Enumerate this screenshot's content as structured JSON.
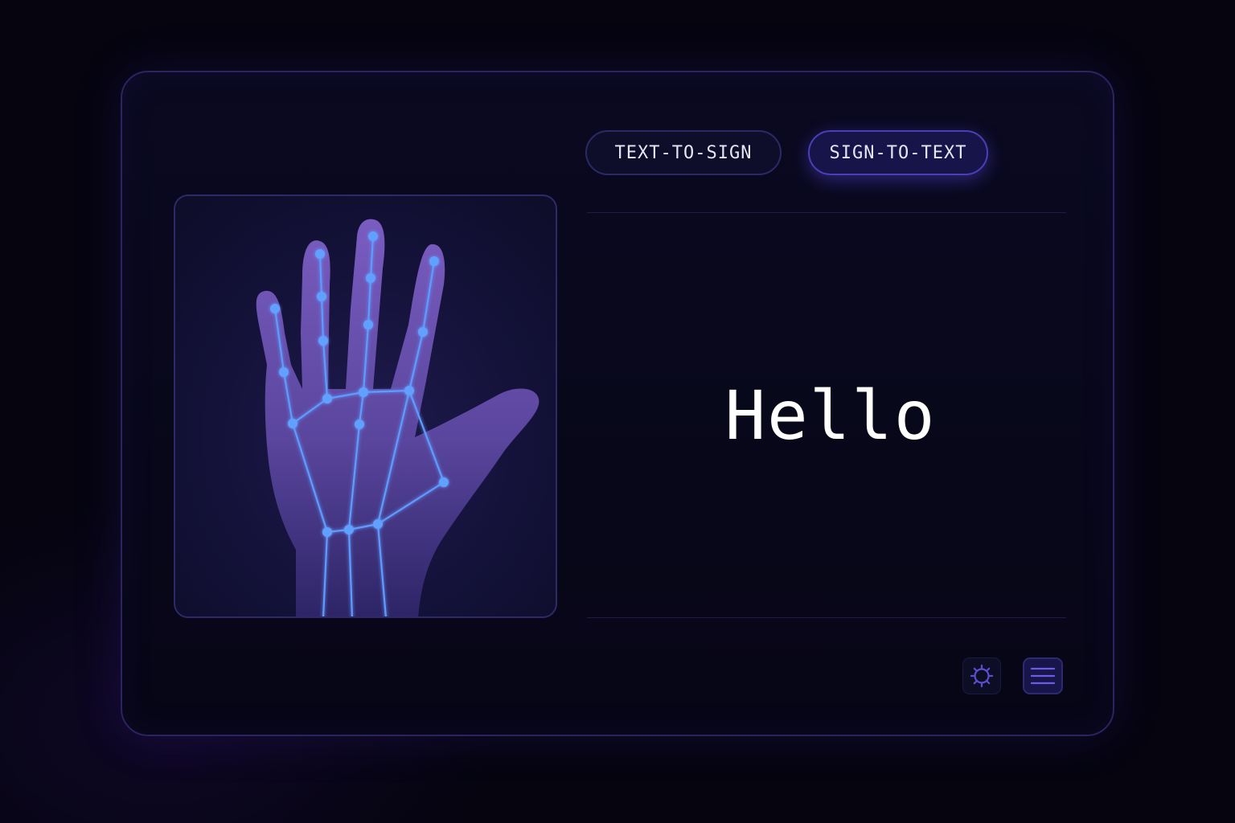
{
  "modes": {
    "text_to_sign": {
      "label": "TEXT-TO-SIGN",
      "active": false
    },
    "sign_to_text": {
      "label": "SIGN-TO-TEXT",
      "active": true
    }
  },
  "output": {
    "text": "Hello"
  },
  "camera": {
    "icon": "hand-landmarks-icon"
  },
  "toolbar": {
    "settings": {
      "icon": "gear-icon"
    },
    "menu": {
      "icon": "menu-icon"
    }
  },
  "colors": {
    "background": "#05040f",
    "panel": "#0a0920",
    "panel_border": "#2a2460",
    "accent": "#5a48e0",
    "landmark": "#5f9bff",
    "text": "#ffffff"
  }
}
